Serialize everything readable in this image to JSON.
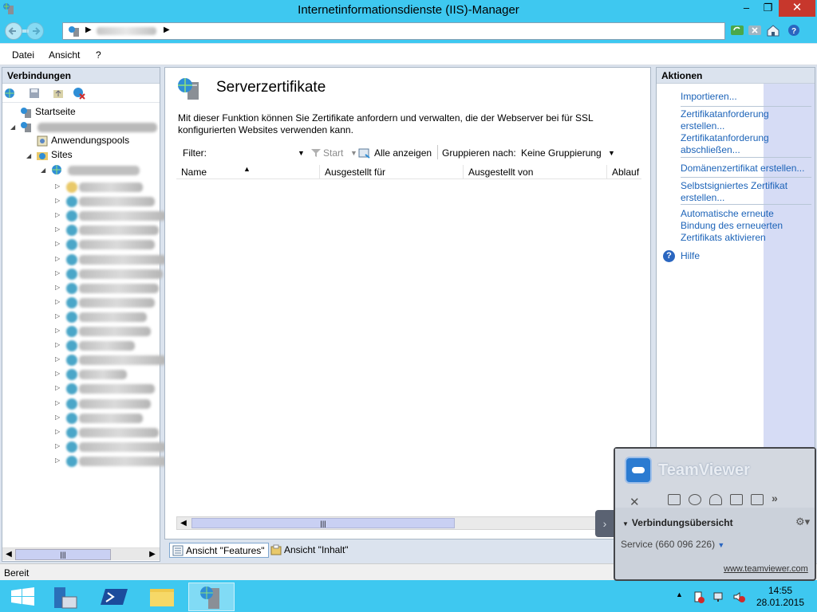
{
  "window": {
    "title": "Internetinformationsdienste (IIS)-Manager",
    "minimize": "–",
    "maximize": "❐",
    "close": "✕"
  },
  "menu": {
    "items": [
      "Datei",
      "Ansicht",
      "?"
    ]
  },
  "connections": {
    "header": "Verbindungen",
    "tree": {
      "start_page": "Startseite",
      "app_pools": "Anwendungspools",
      "sites": "Sites"
    }
  },
  "feature": {
    "title": "Serverzertifikate",
    "description": "Mit dieser Funktion können Sie Zertifikate anfordern und verwalten, die der Webserver bei für SSL konfigurierten Websites verwenden kann.",
    "filter_label": "Filter:",
    "start_label": "Start",
    "show_all_label": "Alle anzeigen",
    "group_by_label": "Gruppieren nach:",
    "group_by_value": "Keine Gruppierung",
    "columns": [
      "Name",
      "Ausgestellt für",
      "Ausgestellt von",
      "Ablauf"
    ]
  },
  "view_tabs": {
    "features": "Ansicht \"Features\"",
    "content": "Ansicht \"Inhalt\""
  },
  "actions": {
    "header": "Aktionen",
    "import": "Importieren...",
    "create_request": "Zertifikatanforderung erstellen...",
    "complete_request": "Zertifikatanforderung abschließen...",
    "domain_cert": "Domänenzertifikat erstellen...",
    "self_signed": "Selbstsigniertes Zertifikat erstellen...",
    "auto_rebind": "Automatische erneute Bindung des erneuerten Zertifikats aktivieren",
    "help": "Hilfe"
  },
  "status": {
    "text": "Bereit"
  },
  "teamviewer": {
    "brand": "TeamViewer",
    "section": "Verbindungsübersicht",
    "service": "Service (660 096 226)",
    "link": "www.teamviewer.com"
  },
  "taskbar": {
    "time": "14:55",
    "date": "28.01.2015"
  },
  "colors": {
    "accent": "#3ec8f0",
    "link": "#1c63b8",
    "close": "#c7372c"
  }
}
